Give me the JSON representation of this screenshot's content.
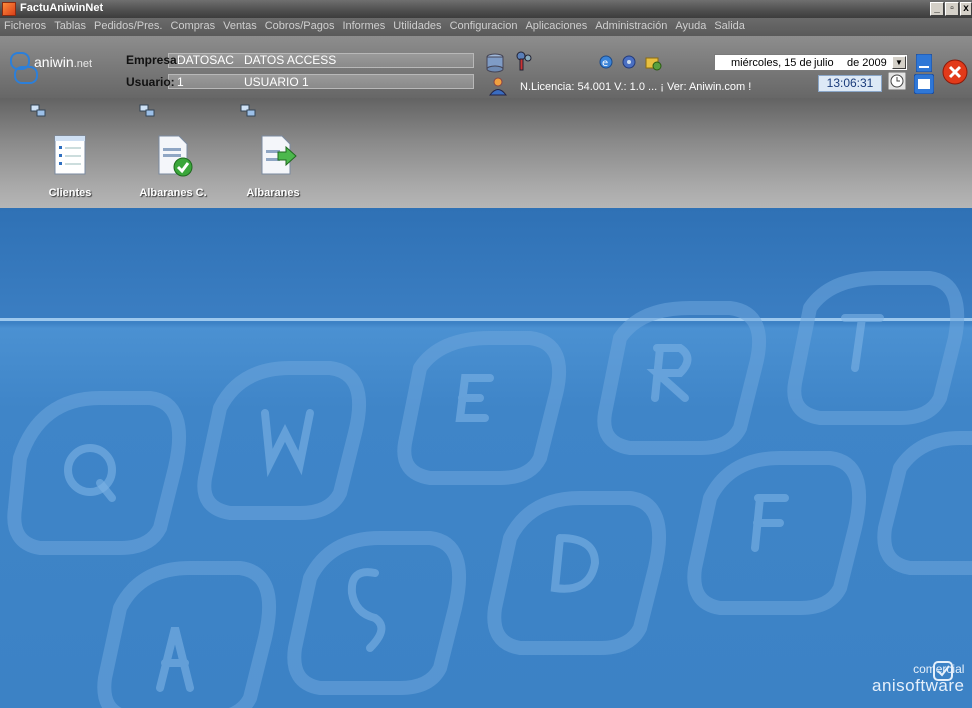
{
  "window": {
    "title": "FactuAniwinNet"
  },
  "menu": {
    "items": [
      "Ficheros",
      "Tablas",
      "Pedidos/Pres.",
      "Compras",
      "Ventas",
      "Cobros/Pagos",
      "Informes",
      "Utilidades",
      "Configuracion",
      "Aplicaciones",
      "Administración",
      "Ayuda",
      "Salida"
    ]
  },
  "logo": {
    "name": "aniwin",
    "suffix": ".net"
  },
  "company": {
    "label": "Empresa:",
    "code": "DATOSAC",
    "name": "DATOS ACCESS"
  },
  "user": {
    "label": "Usuario:",
    "code": "1",
    "name": "USUARIO 1"
  },
  "status": {
    "text": "N.Licencia: 54.001   V.: 1.0  ...  ¡ Ver: Aniwin.com !"
  },
  "date": {
    "weekday_day": "miércoles, 15 de",
    "month": "julio",
    "year": "de 2009"
  },
  "time": "13:06:31",
  "shortcuts": [
    {
      "label": "Clientes",
      "icon": "document-list-icon"
    },
    {
      "label": "Albaranes C.",
      "icon": "document-check-icon"
    },
    {
      "label": "Albaranes",
      "icon": "document-arrow-icon"
    }
  ],
  "brand": {
    "line1": "comercial",
    "line2": "anisoftware"
  },
  "colors": {
    "accent": "#3f85c8",
    "menu_text": "#cfcfcf",
    "time_bg": "#dde9f6",
    "exit_red": "#e23a1a"
  }
}
